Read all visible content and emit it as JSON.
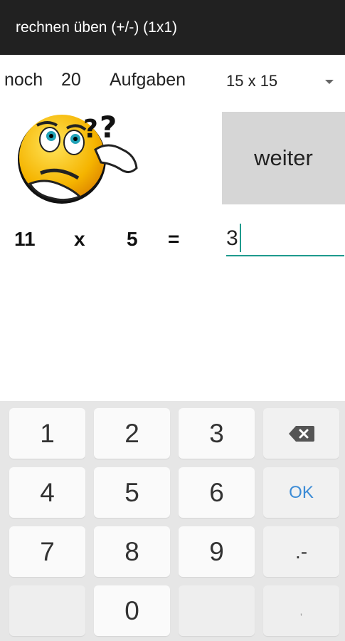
{
  "appbar": {
    "title": "rechnen üben (+/-) (1x1)"
  },
  "progress": {
    "prefix": "noch",
    "remaining": "20",
    "suffix": "Aufgaben"
  },
  "range_select": {
    "selected": "15 x 15"
  },
  "weiter_button": {
    "label": "weiter"
  },
  "task": {
    "operand1": "11",
    "operator": "x",
    "operand2": "5",
    "equals": "="
  },
  "answer_field": {
    "value": "3"
  },
  "keyboard": {
    "keys": [
      "1",
      "2",
      "3",
      "4",
      "5",
      "6",
      "7",
      "8",
      "9",
      "0"
    ],
    "ok_label": "OK",
    "symbol_key": ".-",
    "comma_key": ","
  },
  "icons": {
    "thinking_face": "thinking-emoji-icon",
    "backspace": "backspace-icon",
    "dropdown": "dropdown-arrow-icon"
  },
  "colors": {
    "appbar": "#212121",
    "accent": "#1e9a8d",
    "ok": "#3b8bd6"
  }
}
